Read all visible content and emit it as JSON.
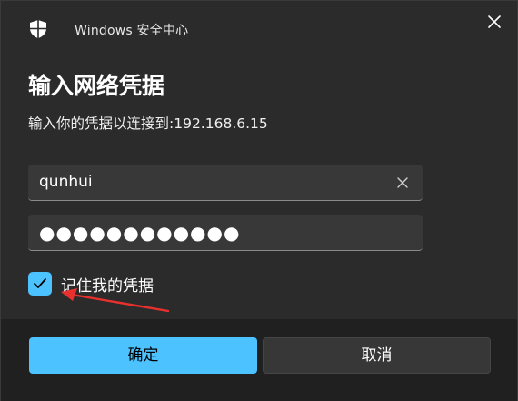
{
  "window": {
    "app_title": "Windows 安全中心",
    "icons": {
      "app": "shield-icon",
      "close": "close-icon"
    }
  },
  "content": {
    "heading": "输入网络凭据",
    "description": "输入你的凭据以连接到:192.168.6.15"
  },
  "fields": {
    "username": {
      "value": "qunhui",
      "clear_icon": "clear-icon"
    },
    "password": {
      "masked_value": "●●●●●●●●●●●●"
    }
  },
  "remember": {
    "label": "记住我的凭据",
    "checked": true
  },
  "buttons": {
    "ok_label": "确定",
    "cancel_label": "取消"
  },
  "colors": {
    "accent": "#4cc2ff",
    "background": "#2b2b2b",
    "footer": "#202020",
    "annotation_arrow": "#e8312e"
  }
}
